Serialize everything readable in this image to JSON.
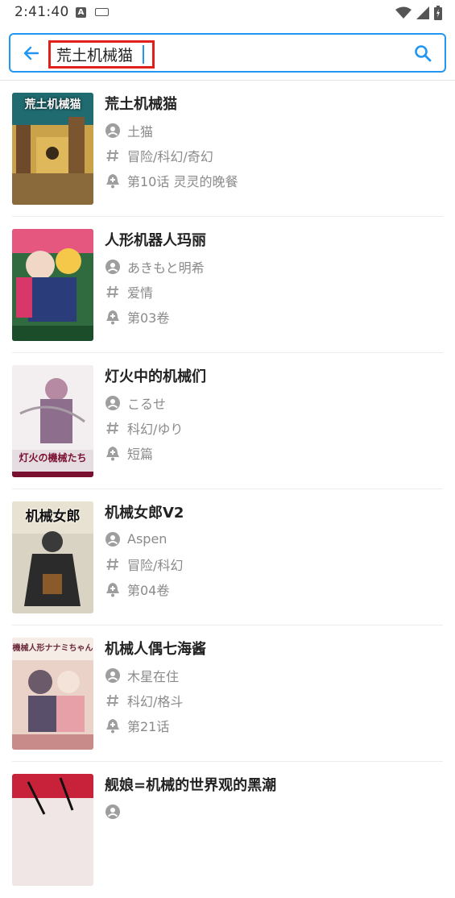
{
  "status_bar": {
    "time": "2:41:40"
  },
  "search": {
    "query": "荒土机械猫",
    "accent_color": "#2196f3",
    "highlight_color": "#e0201a"
  },
  "results": [
    {
      "title": "荒土机械猫",
      "author": "土猫",
      "tags": "冒险/科幻/奇幻",
      "latest": "第10话 灵灵的晚餐",
      "cover_text": "荒土机械猫"
    },
    {
      "title": "人形机器人玛丽",
      "author": "あきもと明希",
      "tags": "爱情",
      "latest": "第03卷",
      "cover_text": ""
    },
    {
      "title": "灯火中的机械们",
      "author": "こるせ",
      "tags": "科幻/ゆり",
      "latest": "短篇",
      "cover_text": "灯火の機械たち"
    },
    {
      "title": "机械女郎V2",
      "author": "Aspen",
      "tags": "冒险/科幻",
      "latest": "第04卷",
      "cover_text": "机械女郎"
    },
    {
      "title": "机械人偶七海酱",
      "author": "木星在住",
      "tags": "科幻/格斗",
      "latest": "第21话",
      "cover_text": "機械人形ナナミちゃん"
    },
    {
      "title": "舰娘=机械的世界观的黑潮",
      "author": "",
      "tags": "",
      "latest": "",
      "cover_text": ""
    }
  ],
  "icons": {
    "back": "arrow-left-icon",
    "search": "search-icon",
    "author": "person-icon",
    "tags": "hash-icon",
    "latest": "bell-plus-icon"
  }
}
